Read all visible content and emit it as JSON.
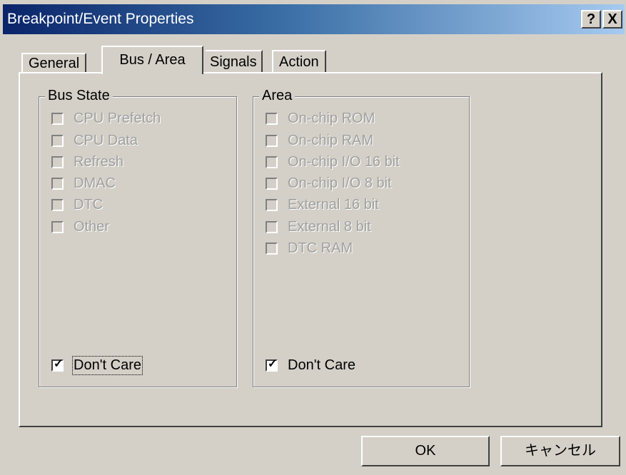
{
  "window": {
    "title": "Breakpoint/Event Properties",
    "help_label": "?",
    "close_label": "X"
  },
  "tabs": [
    {
      "label": "General",
      "selected": false
    },
    {
      "label": "Bus / Area",
      "selected": true
    },
    {
      "label": "Signals",
      "selected": false
    },
    {
      "label": "Action",
      "selected": false
    }
  ],
  "bus_state": {
    "label": "Bus State",
    "items": [
      {
        "label": "CPU Prefetch",
        "checked": false,
        "enabled": false
      },
      {
        "label": "CPU Data",
        "checked": false,
        "enabled": false
      },
      {
        "label": "Refresh",
        "checked": false,
        "enabled": false
      },
      {
        "label": "DMAC",
        "checked": false,
        "enabled": false
      },
      {
        "label": "DTC",
        "checked": false,
        "enabled": false
      },
      {
        "label": "Other",
        "checked": false,
        "enabled": false
      }
    ],
    "dont_care": {
      "label": "Don't Care",
      "checked": true
    }
  },
  "area": {
    "label": "Area",
    "items": [
      {
        "label": "On-chip ROM",
        "checked": false,
        "enabled": false
      },
      {
        "label": "On-chip RAM",
        "checked": false,
        "enabled": false
      },
      {
        "label": "On-chip I/O 16 bit",
        "checked": false,
        "enabled": false
      },
      {
        "label": "On-chip I/O 8 bit",
        "checked": false,
        "enabled": false
      },
      {
        "label": "External 16 bit",
        "checked": false,
        "enabled": false
      },
      {
        "label": "External 8 bit",
        "checked": false,
        "enabled": false
      },
      {
        "label": "DTC RAM",
        "checked": false,
        "enabled": false
      }
    ],
    "dont_care": {
      "label": "Don't Care",
      "checked": true
    }
  },
  "buttons": {
    "ok": "OK",
    "cancel": "キャンセル"
  }
}
